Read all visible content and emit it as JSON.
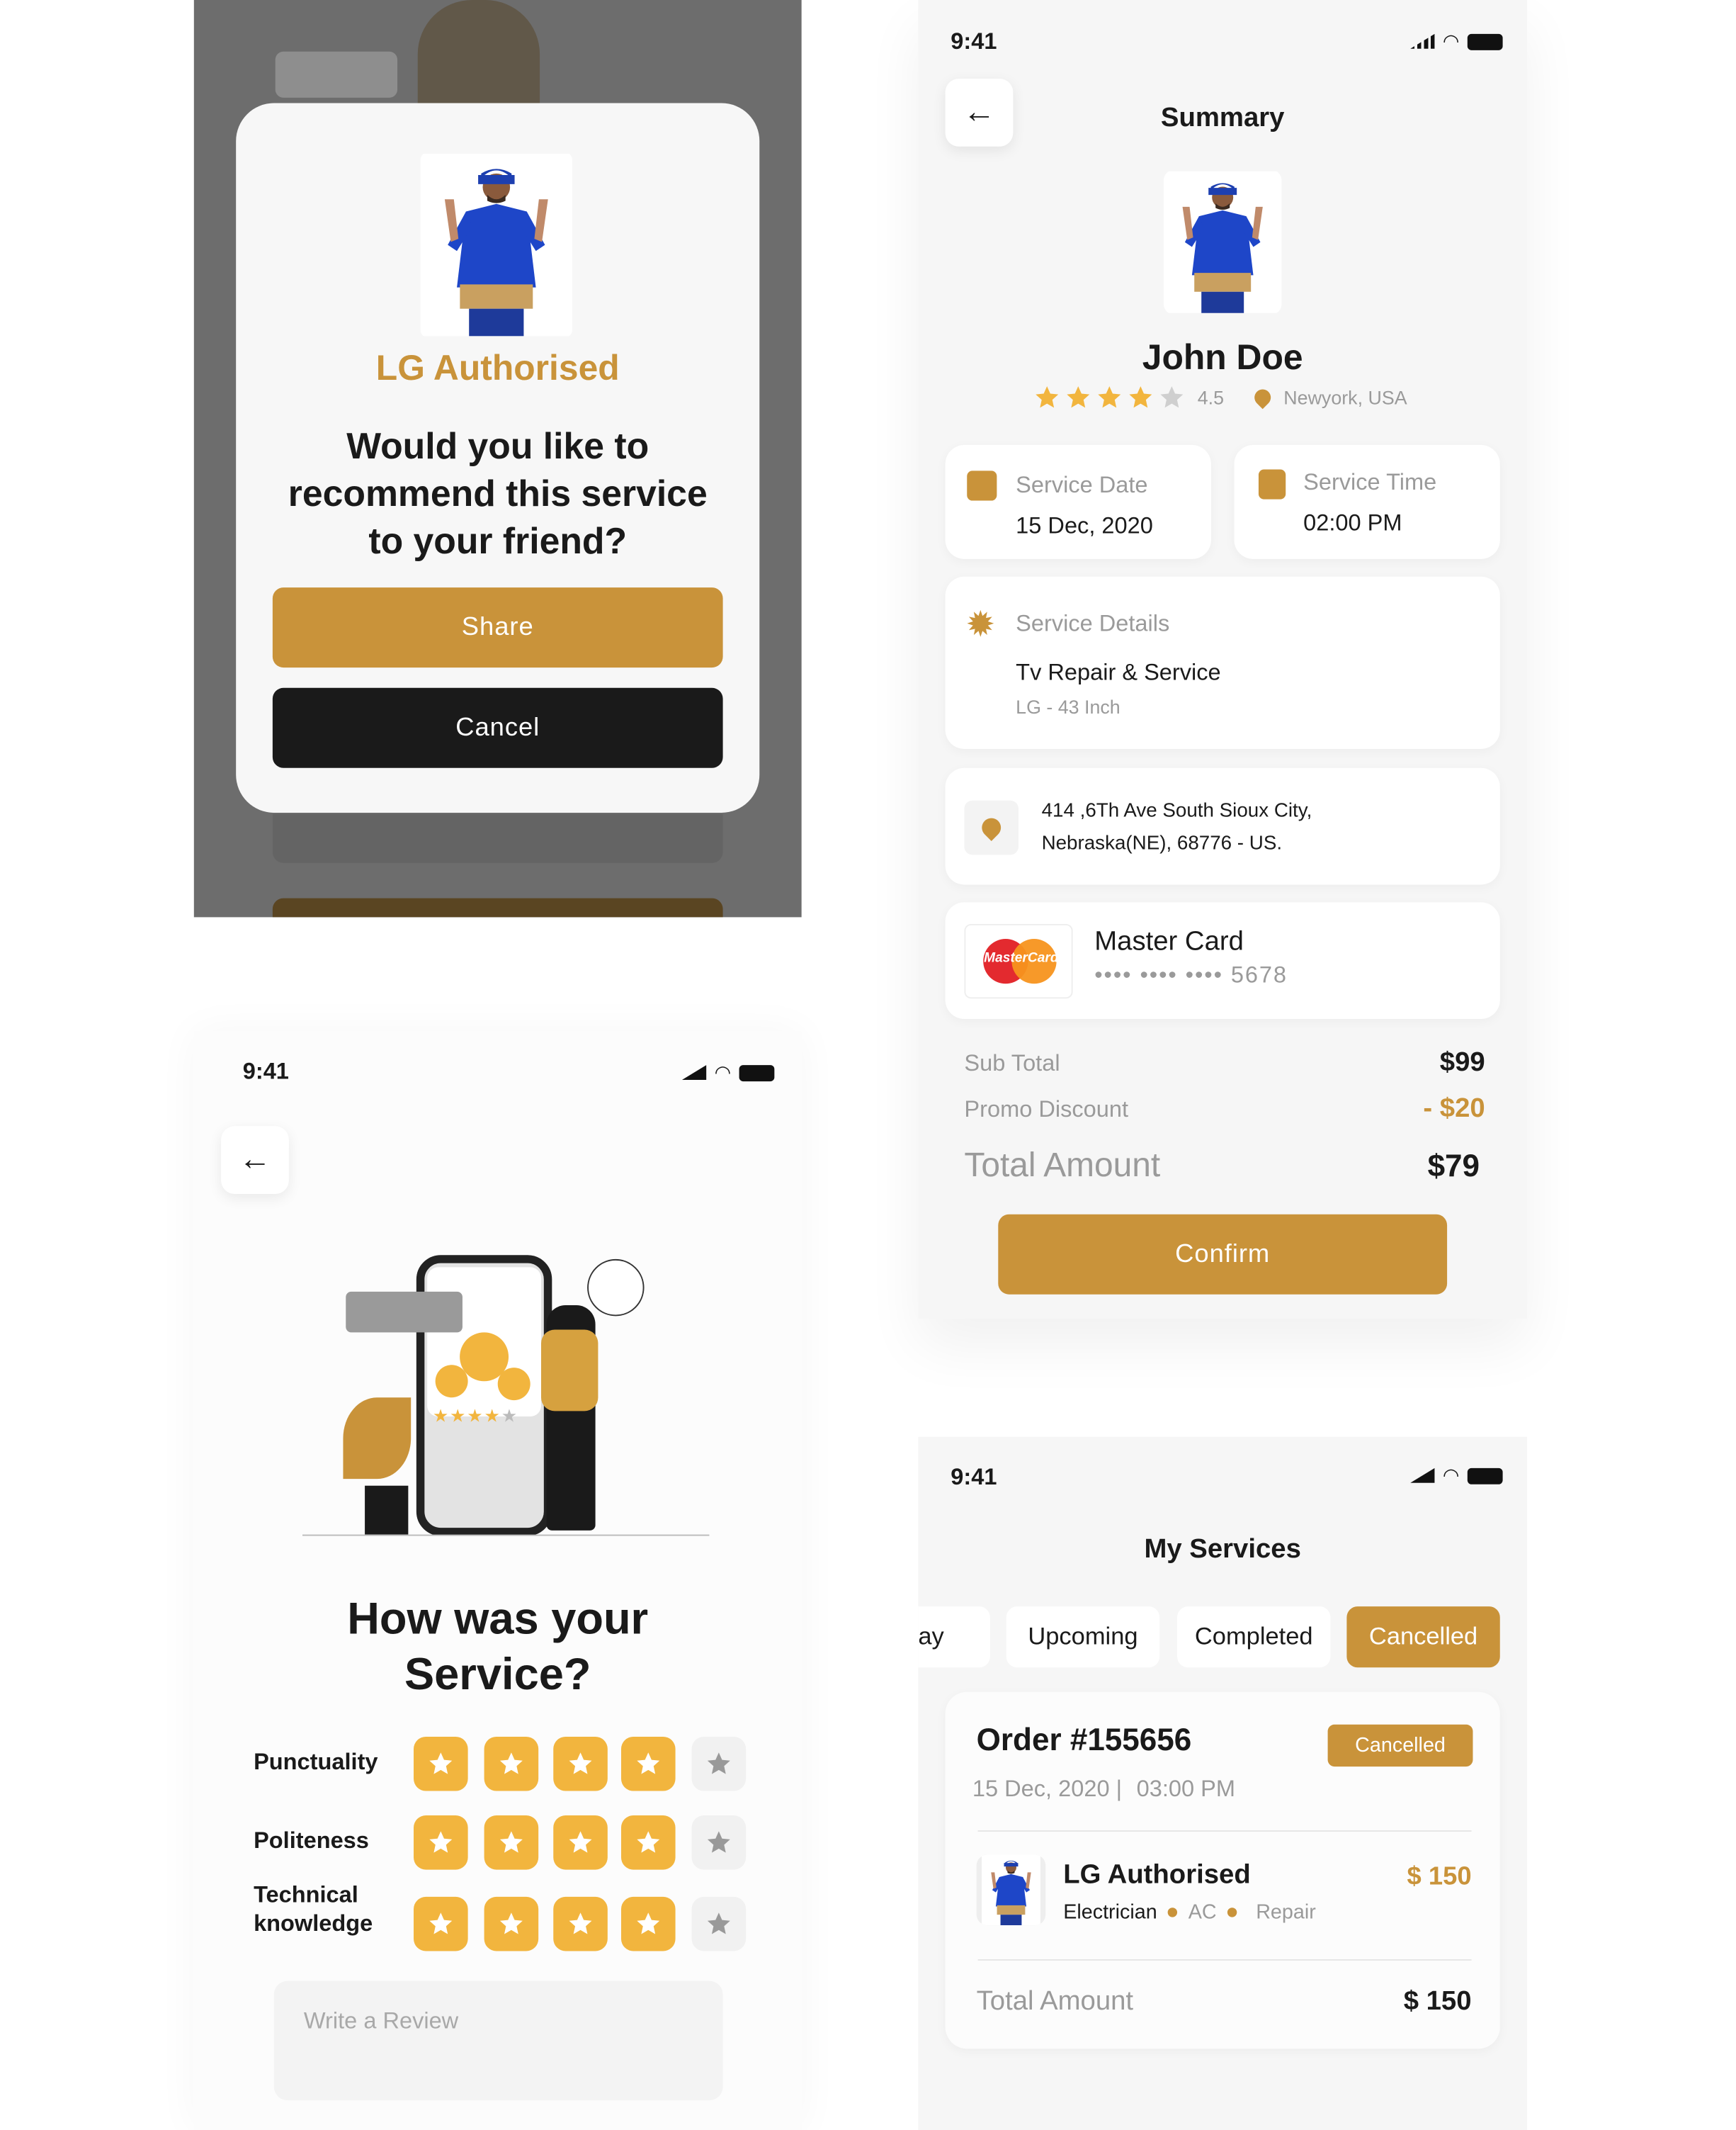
{
  "colors": {
    "accent": "#c9933a",
    "dark": "#1a1a1a",
    "muted": "#9a9a9a"
  },
  "status_bar": {
    "time": "9:41"
  },
  "recommend_modal": {
    "brand": "LG Authorised",
    "question": [
      "Would you like to",
      "recommend this service",
      "to your friend?"
    ],
    "share_label": "Share",
    "cancel_label": "Cancel"
  },
  "summary": {
    "title": "Summary",
    "name": "John Doe",
    "rating": 4.5,
    "rating_label": "4.5",
    "location": "Newyork, USA",
    "service_date_label": "Service Date",
    "service_date": "15 Dec, 2020",
    "service_time_label": "Service Time",
    "service_time": "02:00 PM",
    "service_details_label": "Service Details",
    "service_name": "Tv Repair & Service",
    "service_sub": "LG - 43 Inch",
    "address": [
      "414 ,6Th Ave South Sioux City,",
      "Nebraska(NE), 68776 - US."
    ],
    "card_name": "Master Card",
    "card_number": "•••• •••• •••• 5678",
    "card_logo": "MasterCard",
    "sub_total_label": "Sub Total",
    "sub_total": "$99",
    "promo_label": "Promo Discount",
    "promo": "- $20",
    "total_label": "Total Amount",
    "total": "$79",
    "confirm_label": "Confirm"
  },
  "feedback": {
    "title": [
      "How was your",
      "Service?"
    ],
    "criteria": [
      {
        "label": [
          "Punctuality"
        ],
        "stars": 4
      },
      {
        "label": [
          "Politeness"
        ],
        "stars": 4
      },
      {
        "label": [
          "Technical",
          "knowledge"
        ],
        "stars": 4
      }
    ],
    "review_placeholder": "Write a Review"
  },
  "my_services": {
    "title": "My Services",
    "tabs": [
      "ay",
      "Upcoming",
      "Completed",
      "Cancelled"
    ],
    "active_tab": "Cancelled",
    "order": {
      "number": "Order #155656",
      "status": "Cancelled",
      "date": "15 Dec, 2020 |",
      "time": "03:00 PM",
      "provider": "LG Authorised",
      "price": "$ 150",
      "tags": [
        "Electrician",
        "AC",
        "Repair"
      ],
      "total_label": "Total Amount",
      "total": "$ 150"
    }
  }
}
